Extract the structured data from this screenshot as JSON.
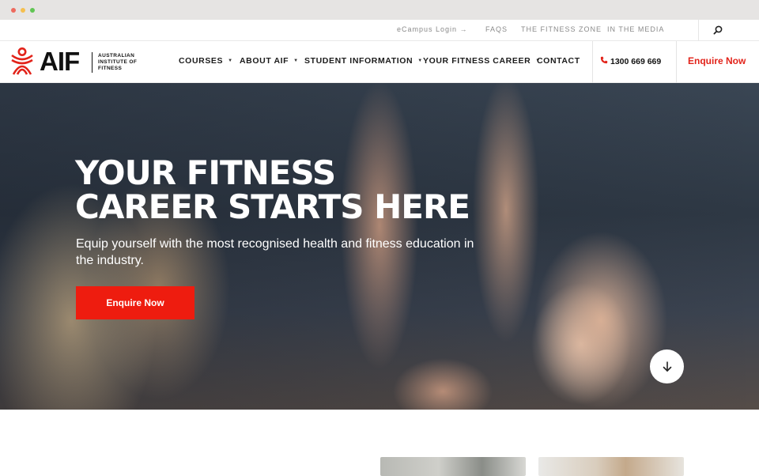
{
  "utility_bar": {
    "ecampus_label": "eCampus Login →",
    "faqs_label": "FAQS",
    "fitness_zone_label": "THE FITNESS ZONE",
    "media_label": "IN THE MEDIA",
    "search_icon": "search-icon"
  },
  "logo": {
    "wordmark": "AIF",
    "subtitle_line1": "AUSTRALIAN",
    "subtitle_line2": "INSTITUTE OF",
    "subtitle_line3": "FITNESS"
  },
  "nav": {
    "items": [
      {
        "label": "COURSES",
        "has_dropdown": true
      },
      {
        "label": "ABOUT AIF",
        "has_dropdown": true
      },
      {
        "label": "STUDENT INFORMATION",
        "has_dropdown": true
      },
      {
        "label": "YOUR FITNESS CAREER",
        "has_dropdown": true
      },
      {
        "label": "CONTACT",
        "has_dropdown": false
      }
    ],
    "phone": "1300 669 669",
    "enquire_label": "Enquire Now"
  },
  "hero": {
    "title_line1": "YOUR FITNESS",
    "title_line2": "CAREER STARTS HERE",
    "subtitle": "Equip yourself with the most recognised health and fitness education in the industry.",
    "cta_label": "Enquire Now",
    "scroll_icon": "arrow-down-icon"
  },
  "colors": {
    "brand_red": "#e2231a",
    "cta_red": "#ee1c0f",
    "text_dark": "#1b1b1b"
  }
}
